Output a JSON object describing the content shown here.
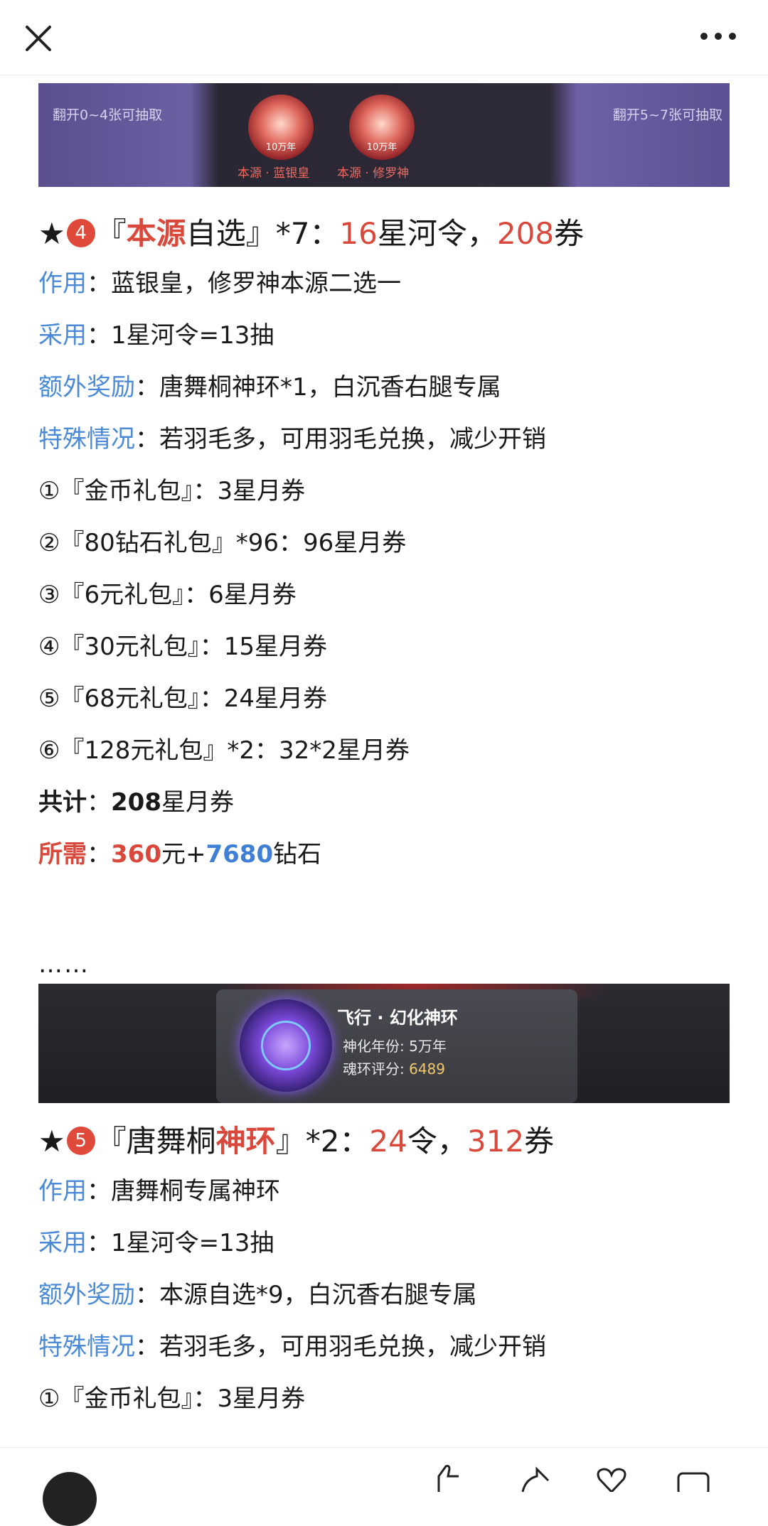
{
  "topbar": {
    "close_icon": "close-icon",
    "more_icon": "more-dots-icon"
  },
  "banner1": {
    "left_text": "翻开0~4张可抽取",
    "right_text": "翻开5~7张可抽取",
    "orbs": [
      {
        "year": "10万年",
        "label": "本源 · 蓝银皇"
      },
      {
        "year": "10万年",
        "label": "本源 · 修罗神"
      }
    ]
  },
  "section4": {
    "star": "★",
    "badge": "4",
    "open": "『",
    "name_red": "本源",
    "name_rest": "自选』*7：",
    "ling_num": "16",
    "ling_text": "星河令，",
    "quan_num": "208",
    "quan_text": "券",
    "rows": [
      {
        "label": "作用",
        "sep": "：",
        "text": "蓝银皇，修罗神本源二选一"
      },
      {
        "label": "采用",
        "sep": "：",
        "text": "1星河令=13抽"
      },
      {
        "label": "额外奖励",
        "sep": "：",
        "text": "唐舞桐神环*1，白沉香右腿专属"
      },
      {
        "label": "特殊情况",
        "sep": "：",
        "text": "若羽毛多，可用羽毛兑换，减少开销"
      }
    ],
    "items": [
      "①『金币礼包』：3星月券",
      "②『80钻石礼包』*96：96星月券",
      "③『6元礼包』：6星月券",
      "④『30元礼包』：15星月券",
      "⑤『68元礼包』：24星月券",
      "⑥『128元礼包』*2：32*2星月券"
    ],
    "total": {
      "label": "共计",
      "sep": "：",
      "num": "208",
      "unit": "星月券"
    },
    "need": {
      "label": "所需",
      "sep": "：",
      "yuan_num": "360",
      "yuan_text": "元+",
      "diamond_num": "7680",
      "diamond_text": "钻石"
    }
  },
  "ellipsis": "……",
  "banner2": {
    "title": "飞行 · 幻化神环",
    "year_label": "神化年份: 5万年",
    "score_label": "魂环评分: ",
    "score_value": "6489"
  },
  "section5": {
    "star": "★",
    "badge": "5",
    "open": "『唐舞桐",
    "name_red": "神环",
    "name_rest": "』*2：",
    "ling_num": "24",
    "ling_text": "令，",
    "quan_num": "312",
    "quan_text": "券",
    "rows": [
      {
        "label": "作用",
        "sep": "：",
        "text": "唐舞桐专属神环"
      },
      {
        "label": "采用",
        "sep": "：",
        "text": "1星河令=13抽"
      },
      {
        "label": "额外奖励",
        "sep": "：",
        "text": "本源自选*9，白沉香右腿专属"
      },
      {
        "label": "特殊情况",
        "sep": "：",
        "text": "若羽毛多，可用羽毛兑换，减少开销"
      }
    ],
    "items": [
      "①『金币礼包』：3星月券"
    ]
  },
  "colors": {
    "accent_red": "#d9483b",
    "accent_blue": "#4a8ad6",
    "badge_red": "#e04a3a"
  }
}
